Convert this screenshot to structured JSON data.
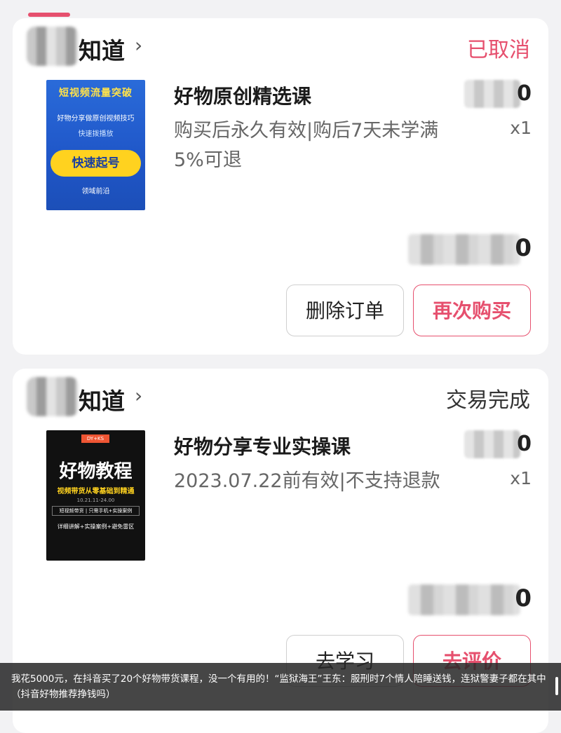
{
  "colors": {
    "accent": "#e6506e",
    "background": "#f2f2f4"
  },
  "orders": [
    {
      "store_name": "知道",
      "status": "已取消",
      "status_color": "#e6506e",
      "thumbnail": {
        "line1": "短视频流量突破",
        "line2": "好物分享做原创视频技巧",
        "line3": "快速拨播放",
        "pill": "快速起号",
        "line4": "领域前沿"
      },
      "title": "好物原创精选课",
      "description": "购买后永久有效|购后7天未学满5%可退",
      "price_visible": "0",
      "quantity": "x1",
      "total_visible": "0",
      "buttons": [
        "删除订单",
        "再次购买"
      ]
    },
    {
      "store_name": "知道",
      "status": "交易完成",
      "status_color": "#333333",
      "thumbnail": {
        "tag": "DY+KS",
        "line1": "好物教程",
        "line2": "视频带货从零基础到精通",
        "line3": "10.21.11-24.00",
        "line4": "短视频带货 | 只需手机+实操案例",
        "line5": "详细讲解+实操案例+避免雷区"
      },
      "title": "好物分享专业实操课",
      "description": "2023.07.22前有效|不支持退款",
      "price_visible": "0",
      "quantity": "x1",
      "total_visible": "0",
      "buttons": [
        "去学习",
        "去评价"
      ]
    }
  ],
  "caption": "我花5000元，在抖音买了20个好物带货课程，没一个有用的！“监狱海王”王东：服刑时7个情人陪睡送钱，连狱警妻子都在其中（抖音好物推荐挣钱吗）"
}
